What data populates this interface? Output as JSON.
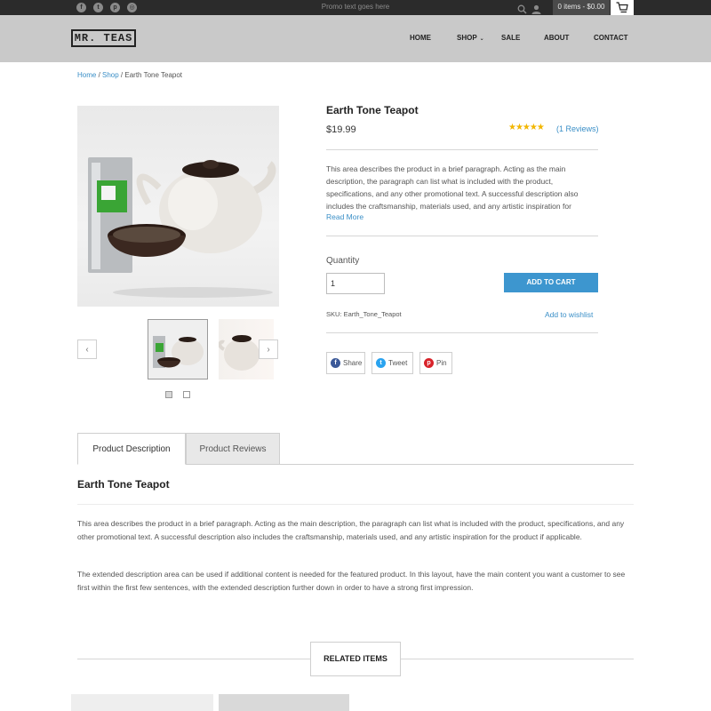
{
  "topbar": {
    "social": [
      {
        "name": "facebook-icon",
        "glyph": "f"
      },
      {
        "name": "twitter-icon",
        "glyph": "t"
      },
      {
        "name": "pinterest-icon",
        "glyph": "p"
      },
      {
        "name": "instagram-icon",
        "glyph": "◎"
      }
    ],
    "promo": "Promo text goes here",
    "cart_summary": "0 items - $0.00"
  },
  "header": {
    "logo": "MR. TEAS",
    "nav": [
      {
        "label": "HOME"
      },
      {
        "label": "SHOP",
        "has_dropdown": true
      },
      {
        "label": "SALE"
      },
      {
        "label": "ABOUT"
      },
      {
        "label": "CONTACT"
      }
    ]
  },
  "breadcrumb": {
    "home": "Home",
    "shop": "Shop",
    "current": "Earth Tone Teapot",
    "sep1": " / ",
    "sep2": " / "
  },
  "product": {
    "title": "Earth Tone Teapot",
    "price": "$19.99",
    "rating": 5,
    "stars": "★★★★★",
    "reviews_link": "(1 Reviews)",
    "description": "This area describes the product in a brief paragraph. Acting as the main description, the paragraph can list what is included with the product, specifications, and any other promotional text. A successful description also includes the craftsmanship, materials used, and any artistic inspiration for",
    "read_more": "Read More",
    "quantity_label": "Quantity",
    "quantity_value": "1",
    "add_to_cart": "ADD TO CART",
    "sku": "SKU: Earth_Tone_Teapot",
    "wishlist": "Add to wishlist",
    "share": [
      {
        "label": "Share",
        "icon": "facebook-icon",
        "color": "#3b5998",
        "glyph": "f"
      },
      {
        "label": "Tweet",
        "icon": "twitter-icon",
        "color": "#2aa3ef",
        "glyph": "t"
      },
      {
        "label": "Pin",
        "icon": "pinterest-icon",
        "color": "#d8232a",
        "glyph": "p"
      }
    ]
  },
  "gallery": {
    "prev": "‹",
    "next": "›"
  },
  "tabs": [
    {
      "label": "Product Description",
      "active": true
    },
    {
      "label": "Product Reviews",
      "active": false
    }
  ],
  "details": {
    "title": "Earth Tone Teapot",
    "paragraphs": [
      "This area describes the product in a brief paragraph. Acting as the main description, the paragraph can list what is included with the product, specifications, and any other promotional text. A successful description also includes the craftsmanship, materials used, and any artistic inspiration for the product if applicable.",
      "The extended description area can be used if additional content is needed for the featured product. In this layout, have the main content you want a customer to see first within the first few sentences, with the extended description further down in order to have a strong first impression."
    ]
  },
  "related": {
    "heading": "RELATED ITEMS"
  },
  "colors": {
    "accent": "#3d96cf",
    "link": "#3a8fc7",
    "star": "#f2b600",
    "topbar": "#2b2b2b",
    "header": "#c9c9c9"
  }
}
